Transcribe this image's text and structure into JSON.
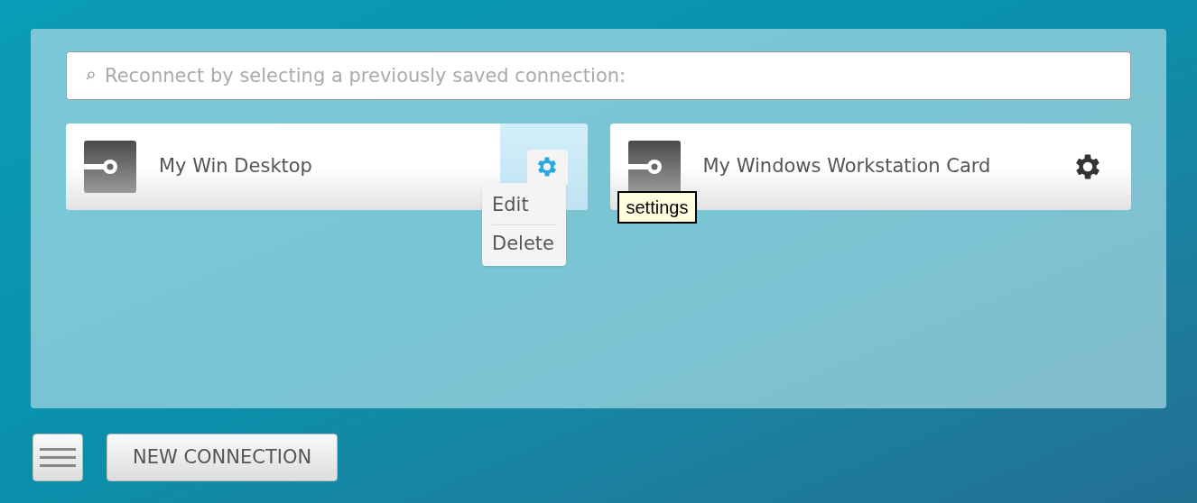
{
  "search": {
    "placeholder": "Reconnect by selecting a previously saved connection:"
  },
  "connections": [
    {
      "name": "My Win Desktop",
      "active": true,
      "menu": [
        "Edit",
        "Delete"
      ]
    },
    {
      "name": "My Windows Workstation Card",
      "active": false,
      "tooltip": "settings"
    }
  ],
  "buttons": [
    "NEW CONNECTION"
  ]
}
